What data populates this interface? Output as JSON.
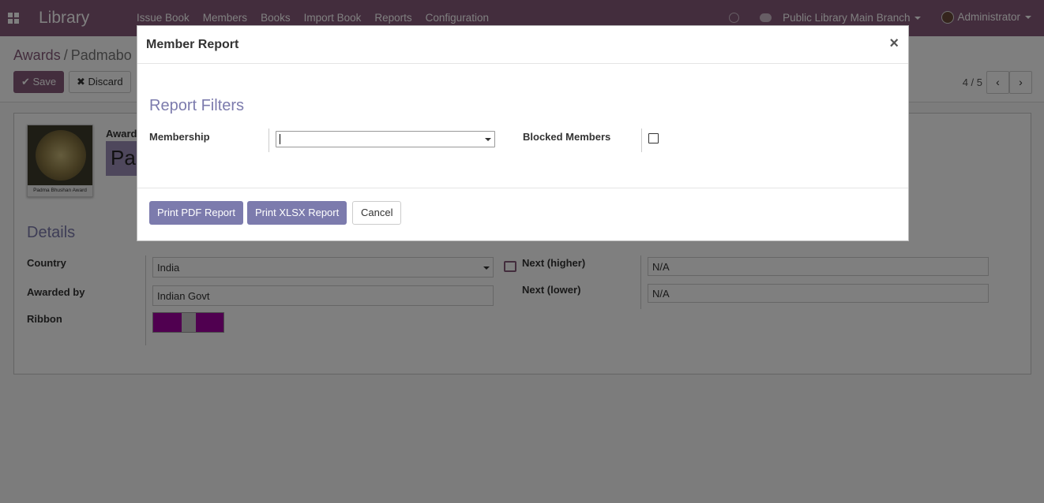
{
  "navbar": {
    "app_title": "Library",
    "menu": [
      "Issue Book",
      "Members",
      "Books",
      "Import Book",
      "Reports",
      "Configuration"
    ],
    "branch": "Public Library Main Branch",
    "user": "Administrator"
  },
  "control": {
    "breadcrumb_root": "Awards",
    "breadcrumb_sep": "/",
    "breadcrumb_current": "Padmabo",
    "save_label": "Save",
    "discard_label": "Discard",
    "pager": "4 / 5",
    "prev_icon": "chevron-left-icon",
    "next_icon": "chevron-right-icon"
  },
  "form": {
    "award_label": "Award",
    "award_name_fragment": "Pa",
    "image_caption": "Padma Bhushan Award",
    "details_title": "Details",
    "country_label": "Country",
    "country_value": "India",
    "awarded_by_label": "Awarded by",
    "awarded_by_value": "Indian Govt",
    "ribbon_label": "Ribbon",
    "next_higher_label": "Next (higher)",
    "next_higher_value": "N/A",
    "next_lower_label": "Next (lower)",
    "next_lower_value": "N/A",
    "ribbon_colors": [
      "#a000a0",
      "#cccccc",
      "#a000a0"
    ]
  },
  "modal": {
    "title": "Member Report",
    "close_icon": "close-icon",
    "section_title": "Report Filters",
    "membership_label": "Membership",
    "membership_value": "",
    "blocked_label": "Blocked Members",
    "blocked_checked": false,
    "print_pdf_label": "Print PDF Report",
    "print_xlsx_label": "Print XLSX Report",
    "cancel_label": "Cancel"
  },
  "colors": {
    "brand": "#875a7b",
    "accent": "#7c7bad"
  }
}
